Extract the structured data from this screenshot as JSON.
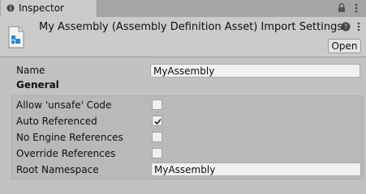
{
  "tab": {
    "label": "Inspector",
    "icon": "info-icon"
  },
  "header": {
    "title": "My Assembly (Assembly Definition Asset) Import Settings",
    "open_label": "Open"
  },
  "name_field": {
    "label": "Name",
    "value": "MyAssembly"
  },
  "general": {
    "title": "General",
    "options": [
      {
        "label": "Allow 'unsafe' Code",
        "checked": false
      },
      {
        "label": "Auto Referenced",
        "checked": true
      },
      {
        "label": "No Engine References",
        "checked": false
      },
      {
        "label": "Override References",
        "checked": false
      }
    ],
    "root_namespace": {
      "label": "Root Namespace",
      "value": "MyAssembly"
    }
  }
}
